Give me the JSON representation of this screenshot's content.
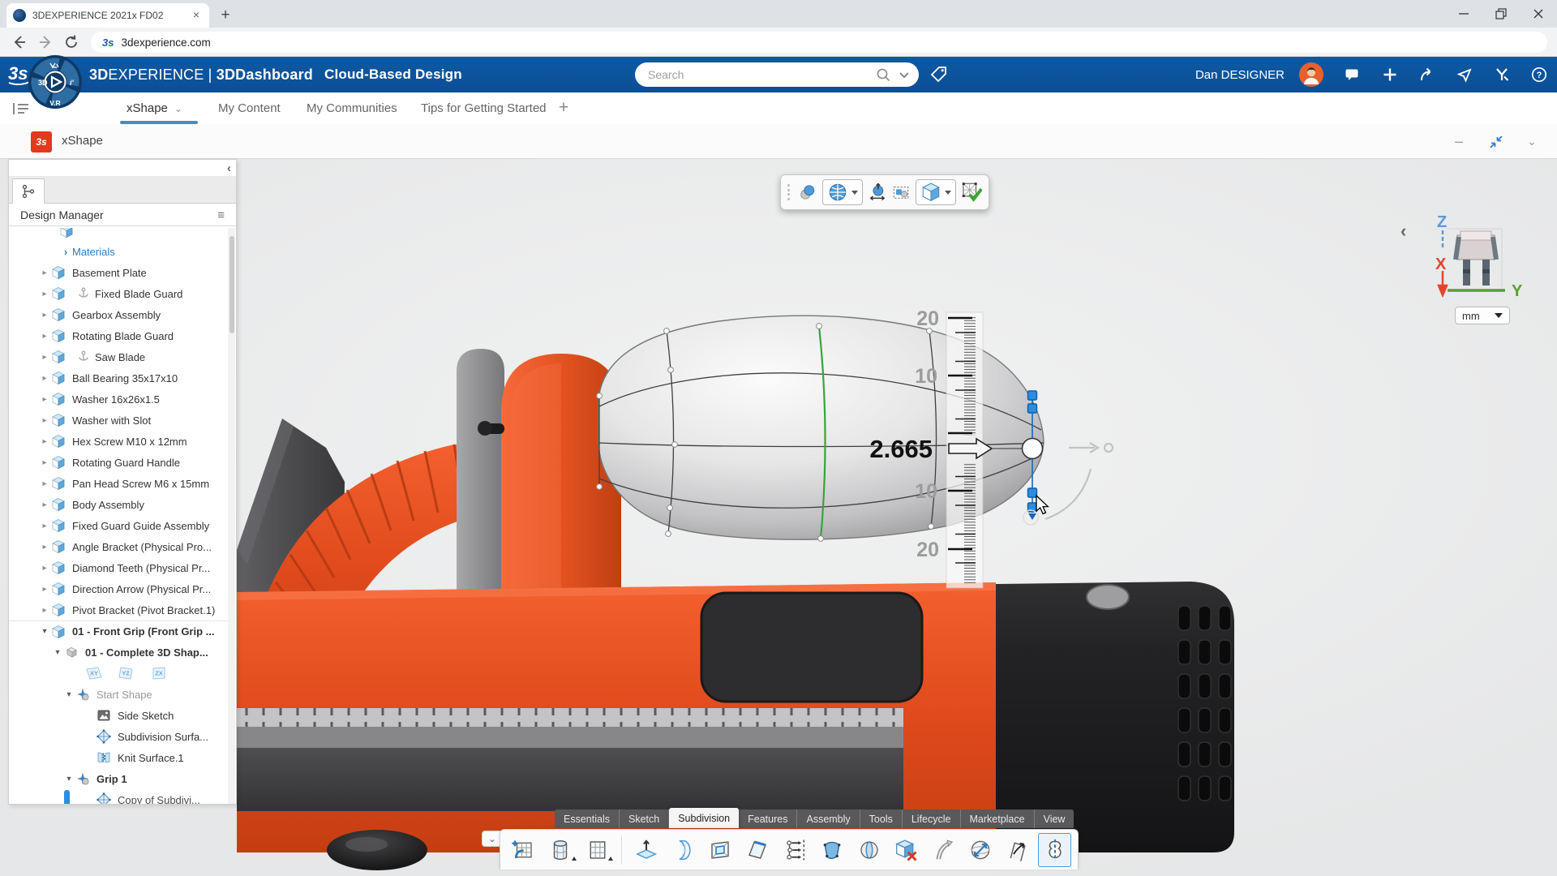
{
  "browser": {
    "tab_title": "3DEXPERIENCE 2021x FD02",
    "url": "3dexperience.com",
    "icons": [
      "tab-favicon",
      "close-tab",
      "new-tab",
      "back",
      "forward",
      "reload",
      "minimize",
      "restore",
      "close"
    ]
  },
  "header": {
    "brand": {
      "b1": "3D",
      "r1": "EXPERIENCE",
      "sep": " | ",
      "b2": "3DDashboard",
      "context": "Cloud-Based Design"
    },
    "search": {
      "placeholder": "Search"
    },
    "user": {
      "name": "Dan DESIGNER"
    },
    "icons": [
      "search",
      "search-options",
      "tag",
      "avatar",
      "notifications",
      "add",
      "forward",
      "share",
      "collaboration",
      "help"
    ],
    "compass": {
      "label_3d": "3D",
      "label_vr": "V.R"
    }
  },
  "nav": {
    "tabs": [
      "xShape",
      "My Content",
      "My Communities",
      "Tips for Getting Started"
    ],
    "active_tab": "xShape",
    "icons": [
      "panel-toggle",
      "tab-dropdown",
      "add-tab"
    ]
  },
  "app_bar": {
    "title": "xShape",
    "icons": [
      "xshape-app",
      "minimize",
      "exit-fullscreen",
      "collapse"
    ]
  },
  "design_manager": {
    "title": "Design Manager",
    "planes": [
      "XY",
      "YZ",
      "ZX"
    ],
    "items": [
      "Materials",
      "Basement Plate",
      "Fixed Blade Guard",
      "Gearbox Assembly",
      "Rotating Blade Guard",
      "Saw Blade",
      "Ball Bearing 35x17x10",
      "Washer 16x26x1.5",
      "Washer with Slot",
      "Hex Screw M10 x 12mm",
      "Rotating Guard Handle",
      "Pan Head Screw M6 x 15mm",
      "Body Assembly",
      "Fixed Guard Guide Assembly",
      "Angle Bracket (Physical Pro...",
      "Diamond Teeth (Physical Pr...",
      "Direction Arrow (Physical Pr...",
      "Pivot Bracket (Pivot Bracket.1)",
      "01 - Front Grip (Front Grip ...",
      "01 - Complete 3D Shap...",
      "Start Shape",
      "Side Sketch",
      "Subdivision Surfa...",
      "Knit Surface.1",
      "Grip 1",
      "Copy of Subdivi..."
    ]
  },
  "viewport": {
    "ruler": {
      "labels": [
        "20",
        "10",
        "10",
        "20"
      ],
      "value": "2.665"
    },
    "axes": {
      "z": "Z",
      "x": "X",
      "y": "Y"
    },
    "units": "mm",
    "view_toolbar_icons": [
      "drag-handle",
      "render-style",
      "view-mode",
      "zoom-scale",
      "symmetry-display",
      "view-cube",
      "validate-check"
    ]
  },
  "ribbon": {
    "tabs": [
      "Essentials",
      "Sketch",
      "Subdivision",
      "Features",
      "Assembly",
      "Tools",
      "Lifecycle",
      "Marketplace",
      "View"
    ],
    "active_tab": "Subdivision",
    "tool_icons": [
      "box-subdivision",
      "cylinder-primitive",
      "grid-primitive",
      "extrude-face",
      "bend-surface",
      "inset-face",
      "crease-edge",
      "multi-extrude",
      "fill-face",
      "split-body",
      "delete-face",
      "sweep-curve",
      "stretch-sphere",
      "align-surface",
      "symmetry-edit"
    ]
  }
}
